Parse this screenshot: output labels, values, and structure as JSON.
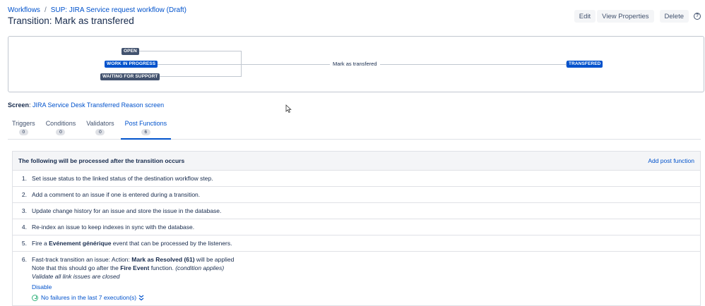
{
  "breadcrumb": {
    "items": [
      "Workflows",
      "SUP: JIRA Service request workflow (Draft)"
    ],
    "separator": "/"
  },
  "title": "Transition: Mark as transfered",
  "actions": {
    "edit": "Edit",
    "view_properties": "View Properties",
    "delete": "Delete",
    "help_icon": "question-circle-icon"
  },
  "diagram": {
    "from_statuses": [
      "OPEN",
      "WORK IN PROGRESS",
      "WAITING FOR SUPPORT"
    ],
    "from_status_colors": [
      "#42526e",
      "#0052cc",
      "#42526e"
    ],
    "transition": "Mark as transfered",
    "to_status": "TRANSFERED",
    "to_status_color": "#0052cc"
  },
  "screen": {
    "label": "Screen",
    "value": "JIRA Service Desk Transferred Reason screen"
  },
  "tabs": [
    {
      "label": "Triggers",
      "count": "0"
    },
    {
      "label": "Conditions",
      "count": "0"
    },
    {
      "label": "Validators",
      "count": "0"
    },
    {
      "label": "Post Functions",
      "count": "6"
    }
  ],
  "active_tab": "Post Functions",
  "post_functions": {
    "header": "The following will be processed after the transition occurs",
    "add_link": "Add post function",
    "items": [
      {
        "num": "1.",
        "text": "Set issue status to the linked status of the destination workflow step."
      },
      {
        "num": "2.",
        "text": "Add a comment to an issue if one is entered during a transition."
      },
      {
        "num": "3.",
        "text": "Update change history for an issue and store the issue in the database."
      },
      {
        "num": "4.",
        "text": "Re-index an issue to keep indexes in sync with the database."
      },
      {
        "num": "5.",
        "pre": "Fire a ",
        "bold": "Evénement générique",
        "post": " event that can be processed by the listeners."
      },
      {
        "num": "6.",
        "line1_pre": "Fast-track transition an issue: Action: ",
        "line1_bold": "Mark as Resolved (61)",
        "line1_post": " will be applied",
        "line2_pre": "Note that this should go after the ",
        "line2_bold": "Fire Event",
        "line2_post": " function. ",
        "line2_italic": "(condition applies)",
        "line3_italic": "Validate all link issues are closed",
        "disable": "Disable",
        "status": "No failures in the last 7 execution(s)",
        "status_icon": "check-circle-icon",
        "expand_icon": "double-chevron-down-icon"
      }
    ]
  },
  "colors": {
    "link": "#0052cc",
    "text": "#172b4d",
    "status_grey": "#42526e",
    "status_blue": "#0052cc",
    "success": "#36b37e"
  }
}
